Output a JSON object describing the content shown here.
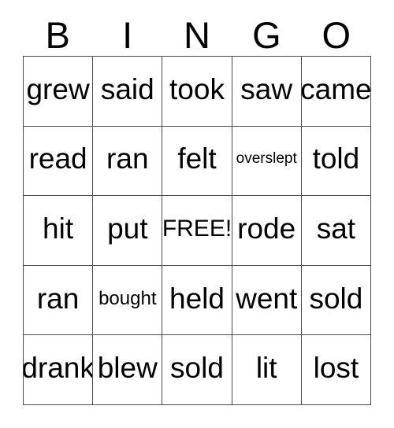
{
  "card": {
    "title": "BINGO",
    "header_letters": [
      "B",
      "I",
      "N",
      "G",
      "O"
    ],
    "columns": 5,
    "rows": 5,
    "free_space": {
      "row": 2,
      "col": 2,
      "label": "FREE!"
    },
    "colors": {
      "background": "#ffffff",
      "text": "#000000",
      "grid_line": "#4c4c4c"
    },
    "rows_data": [
      {
        "cells": [
          {
            "text": "grew",
            "size": "lg"
          },
          {
            "text": "said",
            "size": "lg"
          },
          {
            "text": "took",
            "size": "lg"
          },
          {
            "text": "saw",
            "size": "lg"
          },
          {
            "text": "came",
            "size": "lg"
          }
        ]
      },
      {
        "cells": [
          {
            "text": "read",
            "size": "lg"
          },
          {
            "text": "ran",
            "size": "lg"
          },
          {
            "text": "felt",
            "size": "lg"
          },
          {
            "text": "overslept",
            "size": "xs"
          },
          {
            "text": "told",
            "size": "lg"
          }
        ]
      },
      {
        "cells": [
          {
            "text": "hit",
            "size": "lg"
          },
          {
            "text": "put",
            "size": "lg"
          },
          {
            "text": "FREE!",
            "size": "md"
          },
          {
            "text": "rode",
            "size": "lg"
          },
          {
            "text": "sat",
            "size": "lg"
          }
        ]
      },
      {
        "cells": [
          {
            "text": "ran",
            "size": "lg"
          },
          {
            "text": "bought",
            "size": "sm"
          },
          {
            "text": "held",
            "size": "lg"
          },
          {
            "text": "went",
            "size": "lg"
          },
          {
            "text": "sold",
            "size": "lg"
          }
        ]
      },
      {
        "cells": [
          {
            "text": "drank",
            "size": "lg"
          },
          {
            "text": "blew",
            "size": "lg"
          },
          {
            "text": "sold",
            "size": "lg"
          },
          {
            "text": "lit",
            "size": "lg"
          },
          {
            "text": "lost",
            "size": "lg"
          }
        ]
      }
    ]
  }
}
